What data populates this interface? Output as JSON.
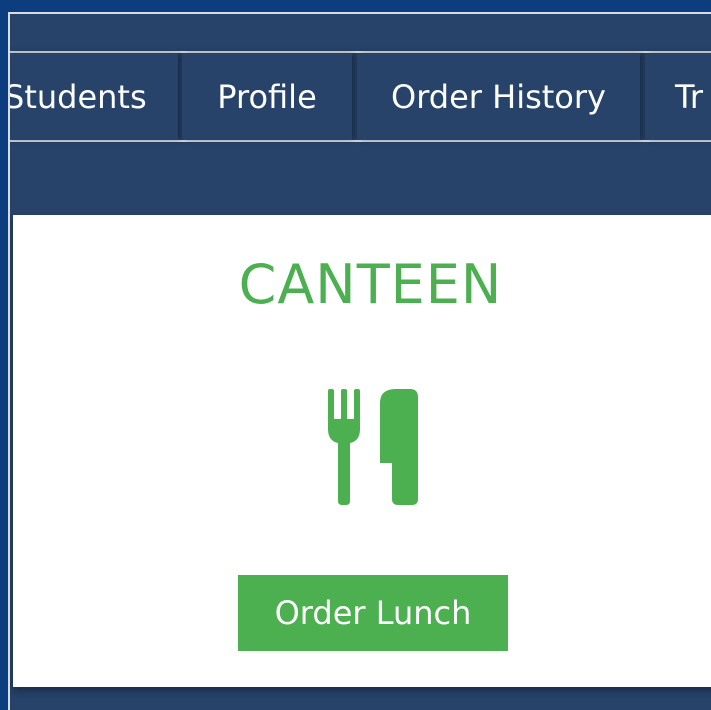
{
  "nav": {
    "items": [
      {
        "label": "Students"
      },
      {
        "label": "Profile"
      },
      {
        "label": "Order History"
      },
      {
        "label": "Tr"
      }
    ]
  },
  "canteen": {
    "title": "CANTEEN",
    "icon": "cutlery-icon",
    "button_label": "Order Lunch"
  },
  "colors": {
    "page_background": "#0b3d7f",
    "nav_background": "#27436a",
    "accent_green": "#4caf50",
    "card_background": "#ffffff"
  }
}
